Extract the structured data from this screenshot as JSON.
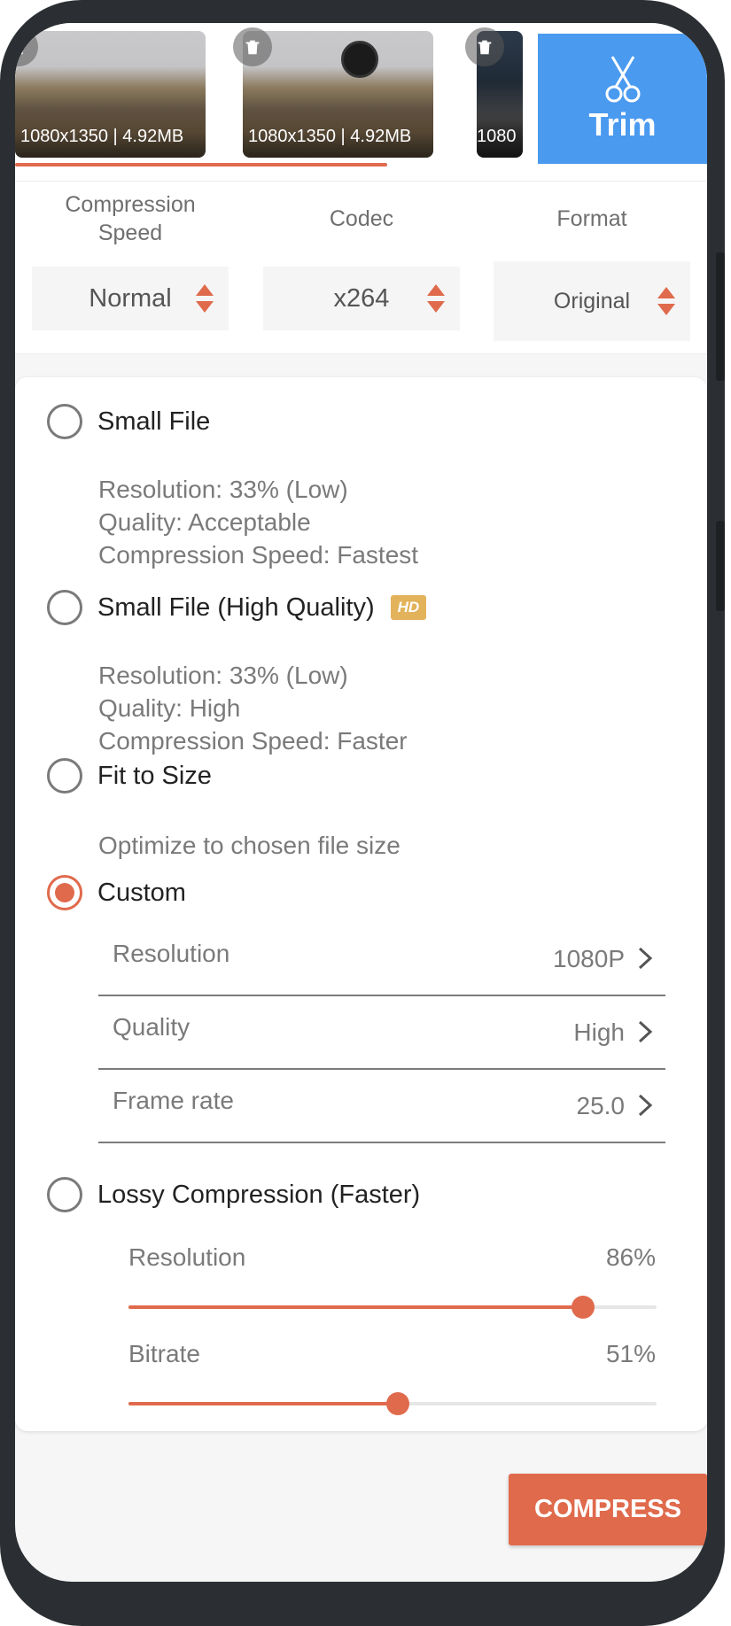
{
  "thumbnails": [
    {
      "caption": "1080x1350 | 4.92MB",
      "delete_icon": "trash-icon"
    },
    {
      "caption": "1080x1350 | 4.92MB",
      "delete_icon": "trash-icon"
    },
    {
      "caption": "1080",
      "delete_icon": "trash-icon"
    }
  ],
  "trim": {
    "label": "Trim",
    "icon": "scissors-icon"
  },
  "settings": [
    {
      "title": "Compression Speed",
      "value": "Normal"
    },
    {
      "title": "Codec",
      "value": "x264"
    },
    {
      "title": "Format",
      "value": "Original"
    }
  ],
  "options": {
    "small_file": {
      "label": "Small File",
      "details": [
        "Resolution: 33% (Low)",
        "Quality: Acceptable",
        "Compression Speed: Fastest"
      ]
    },
    "small_file_hq": {
      "label": "Small File (High Quality)",
      "badge": "HD",
      "details": [
        "Resolution: 33% (Low)",
        "Quality: High",
        "Compression Speed: Faster"
      ]
    },
    "fit_to_size": {
      "label": "Fit to Size",
      "details": [
        "Optimize to chosen file size"
      ]
    },
    "custom": {
      "label": "Custom",
      "selected": true,
      "rows": [
        {
          "label": "Resolution",
          "value": "1080P"
        },
        {
          "label": "Quality",
          "value": "High"
        },
        {
          "label": "Frame rate",
          "value": "25.0"
        }
      ]
    },
    "lossy": {
      "label": "Lossy Compression (Faster)",
      "sliders": [
        {
          "label": "Resolution",
          "value_text": "86%",
          "value": 0.86
        },
        {
          "label": "Bitrate",
          "value_text": "51%",
          "value": 0.51
        }
      ]
    }
  },
  "compress_button": {
    "label": "COMPRESS"
  },
  "colors": {
    "accent": "#e06a4c",
    "trim_blue": "#4a9af0",
    "hd_badge": "#e2b35b"
  }
}
